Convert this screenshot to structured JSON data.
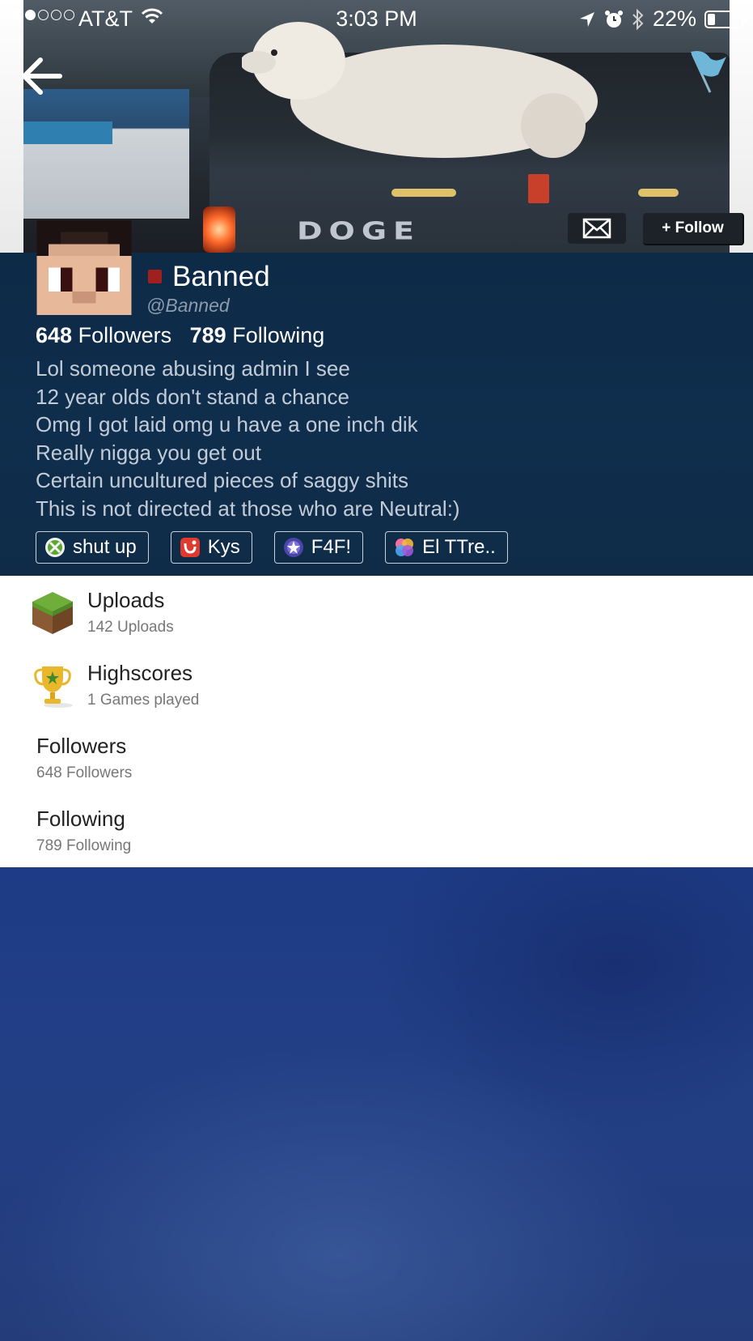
{
  "status_bar": {
    "carrier": "AT&T",
    "time": "3:03 PM",
    "battery_percent": "22%",
    "battery_level": 0.22,
    "signal_bars_filled": 2,
    "signal_bars_total": 5
  },
  "cover": {
    "photo_text": "DOGE"
  },
  "header_actions": {
    "follow_label": "+ Follow"
  },
  "profile": {
    "name": "Banned",
    "handle": "@Banned",
    "followers_count": "648",
    "followers_label": "Followers",
    "following_count": "789",
    "following_label": "Following",
    "status_color": "#a01f1f",
    "bio": [
      "Lol someone abusing admin I see",
      "12 year olds don't stand a chance",
      "Omg I got laid omg u have a one inch dik",
      "Really nigga you get out",
      "Certain uncultured pieces of saggy shits",
      "This is not directed at those who are Neutral:)"
    ],
    "badges": [
      {
        "icon": "xbox-icon",
        "label": "shut up"
      },
      {
        "icon": "app-icon",
        "label": "Kys"
      },
      {
        "icon": "star-badge-icon",
        "label": "F4F!"
      },
      {
        "icon": "game-center-icon",
        "label": "El TTre.."
      }
    ]
  },
  "menu": [
    {
      "icon": "grass-block-icon",
      "title": "Uploads",
      "subtitle": "142 Uploads"
    },
    {
      "icon": "trophy-icon",
      "title": "Highscores",
      "subtitle": "1 Games played"
    },
    {
      "icon": "",
      "title": "Followers",
      "subtitle": "648 Followers"
    },
    {
      "icon": "",
      "title": "Following",
      "subtitle": "789 Following"
    }
  ],
  "colors": {
    "profile_panel": "#0f2e4d",
    "background_blue": "#1f3b82"
  }
}
